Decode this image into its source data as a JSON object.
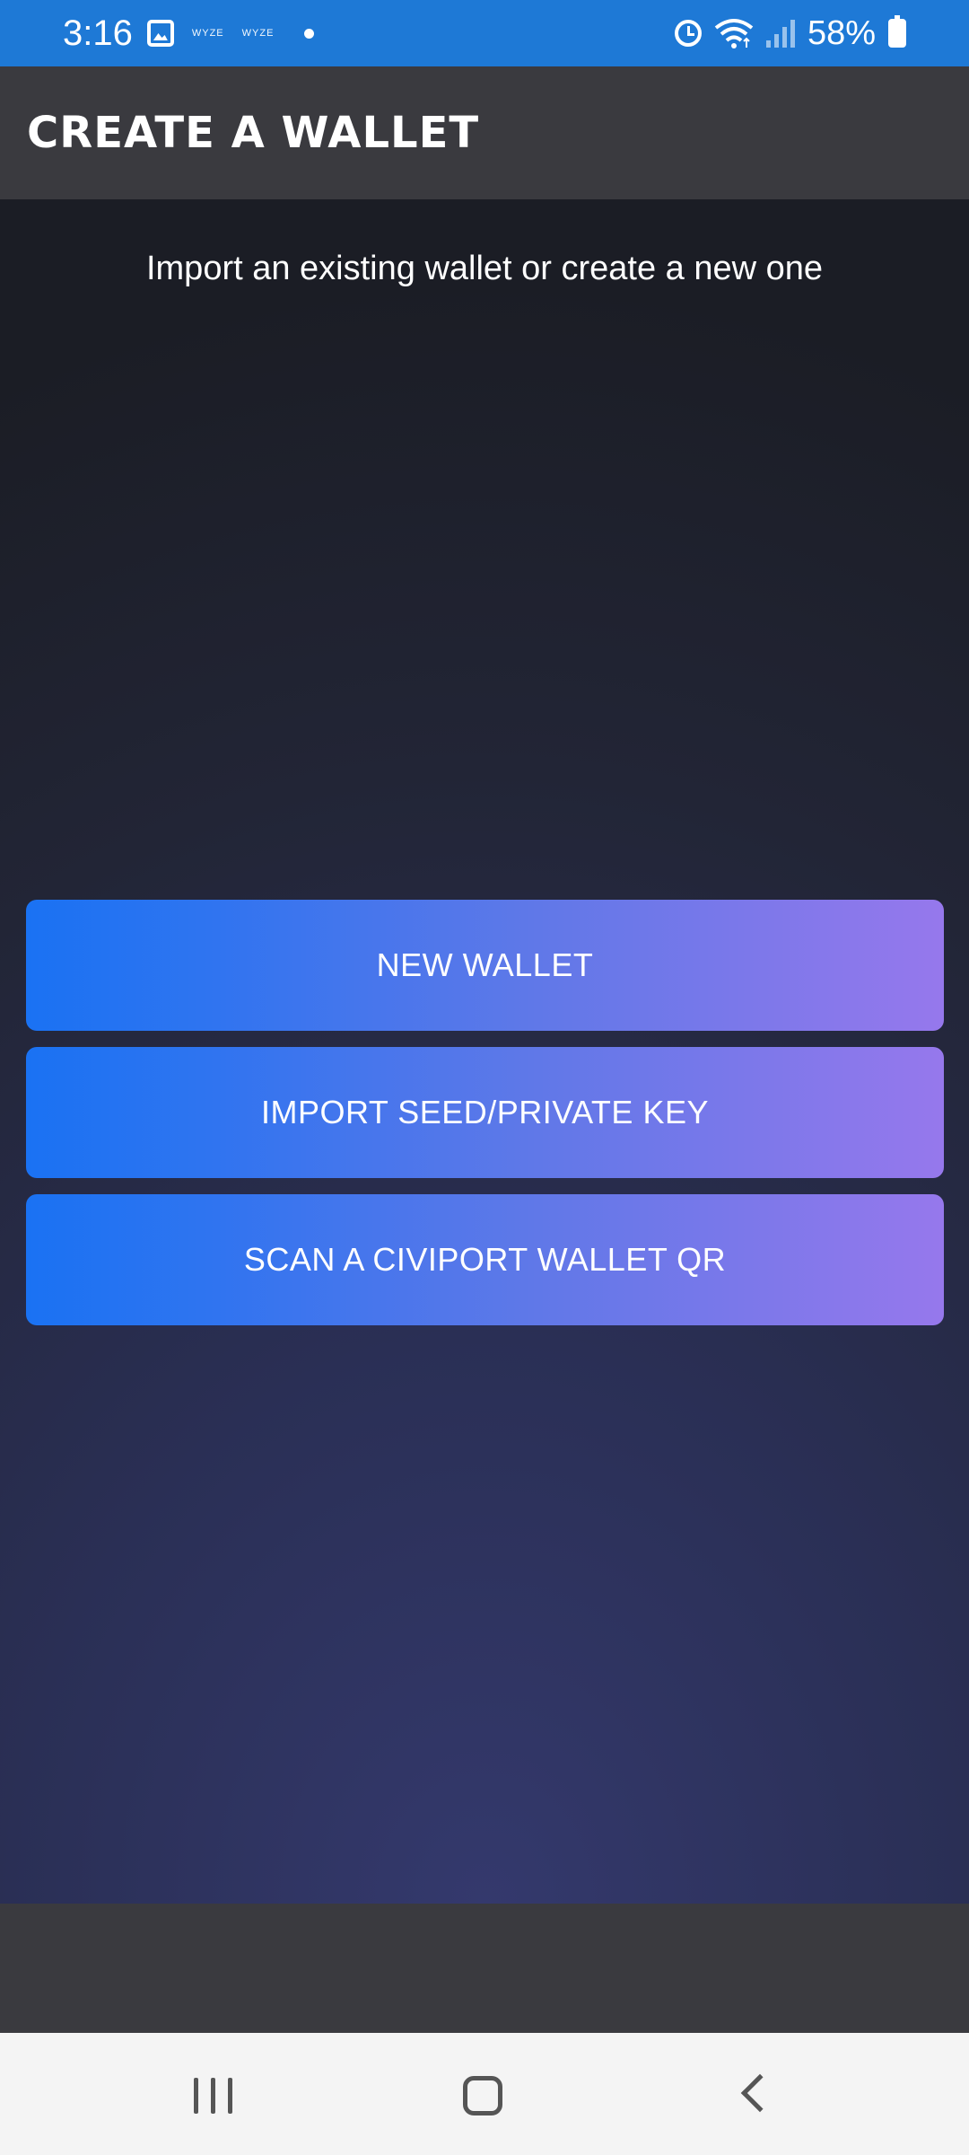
{
  "status_bar": {
    "time": "3:16",
    "notification_icons": [
      "image-icon",
      "wyze-icon",
      "wyze-icon",
      "dot-icon"
    ],
    "wyze_label_1": "WYZE",
    "wyze_label_2": "WYZE",
    "status_icons": [
      "alarm-icon",
      "wifi-icon",
      "signal-icon",
      "battery-icon"
    ],
    "battery_percent": "58%"
  },
  "app_bar": {
    "title": "CREATE A WALLET"
  },
  "main": {
    "subtitle": "Import an existing wallet or create a new one",
    "buttons": [
      {
        "label": "NEW WALLET"
      },
      {
        "label": "IMPORT SEED/PRIVATE KEY"
      },
      {
        "label": "SCAN A CIVIPORT WALLET QR"
      }
    ]
  },
  "nav_bar": {
    "icons": [
      "recents-icon",
      "home-icon",
      "back-icon"
    ]
  },
  "colors": {
    "status_bar": "#1e79d6",
    "app_bar": "#3a3a3f",
    "button_gradient_start": "#1a72f3",
    "button_gradient_end": "#9678ec",
    "background_top": "#1b1d25",
    "background_bottom": "#34396d",
    "nav_bar": "#f4f4f4"
  }
}
